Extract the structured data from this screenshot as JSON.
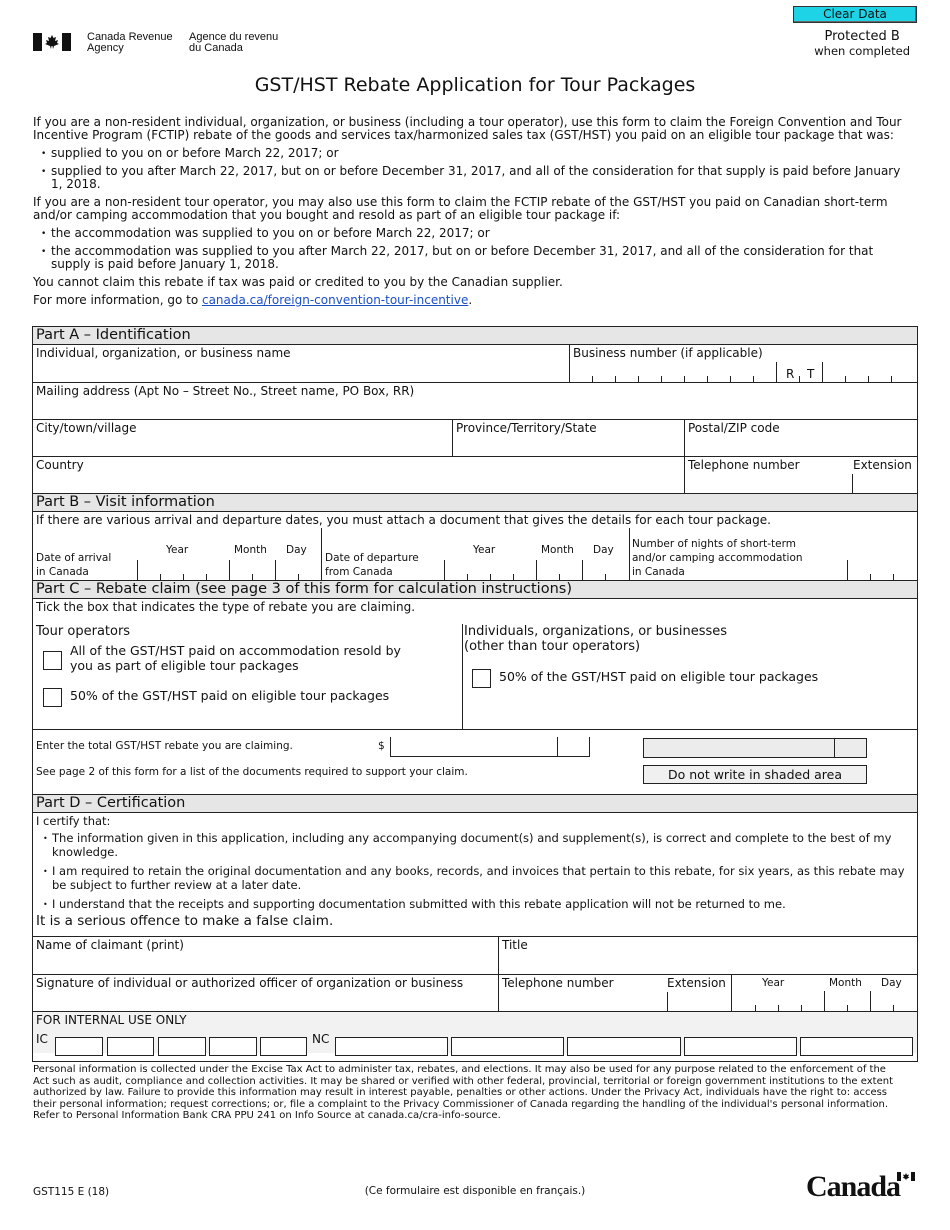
{
  "toolbar": {
    "clear_label": "Clear Data"
  },
  "header": {
    "agency_en_1": "Canada Revenue",
    "agency_en_2": "Agency",
    "agency_fr_1": "Agence du revenu",
    "agency_fr_2": "du Canada",
    "protected_1": "Protected B",
    "protected_2": "when completed",
    "title": "GST/HST Rebate Application for Tour Packages"
  },
  "intro": {
    "p1": "If you are a non-resident individual, organization, or business (including a tour operator), use this form to claim the Foreign Convention and Tour Incentive Program (FCTIP) rebate of the goods and services tax/harmonized sales tax (GST/HST) you paid on an eligible tour package that was:",
    "p1_bullets": [
      "supplied to you on or before March 22, 2017; or",
      "supplied to you after March 22, 2017, but on or before December 31, 2017, and all of the consideration for that supply is paid before January 1, 2018."
    ],
    "p2": "If you are a non-resident tour operator, you may also use this form to claim the FCTIP rebate of the GST/HST you paid on Canadian short-term and/or camping accommodation that you bought and resold as part of an eligible tour package if:",
    "p2_bullets": [
      "the accommodation was supplied to you on or before March 22, 2017; or",
      "the accommodation was supplied to you after March 22, 2017, but on or before December 31, 2017, and all of the consideration for that supply is paid before January 1, 2018."
    ],
    "p3": "You cannot claim this rebate if tax was paid or credited to you by the Canadian supplier.",
    "p4_prefix": "For more information, go to ",
    "p4_link": "canada.ca/foreign-convention-tour-incentive",
    "p4_suffix": "."
  },
  "part_a": {
    "header": "Part A – Identification",
    "name_label": "Individual, organization, or business name",
    "bn_label": "Business number (if applicable)",
    "bn_r": "R",
    "bn_t": "T",
    "address_label": "Mailing address (Apt No – Street No., Street name, PO Box, RR)",
    "city_label": "City/town/village",
    "province_label": "Province/Territory/State",
    "postal_label": "Postal/ZIP code",
    "country_label": "Country",
    "phone_label": "Telephone number",
    "extension_label": "Extension"
  },
  "part_b": {
    "header": "Part B – Visit information",
    "note": "If there are various arrival and departure dates, you must attach a document that gives the details for each tour package.",
    "arrival_label_1": "Date of arrival",
    "arrival_label_2": "in Canada",
    "departure_label_1": "Date of departure",
    "departure_label_2": "from Canada",
    "year": "Year",
    "month": "Month",
    "day": "Day",
    "nights_label_1": "Number of nights of short-term",
    "nights_label_2": "and/or camping accommodation",
    "nights_label_3": "in Canada"
  },
  "part_c": {
    "header": "Part C – Rebate claim (see page 3 of this form for calculation instructions)",
    "instruction": "Tick the box that indicates the type of rebate you are claiming.",
    "tour_ops_heading": "Tour operators",
    "tour_opt1_line1": "All of the GST/HST paid on accommodation resold by",
    "tour_opt1_line2": "you as part of eligible tour packages",
    "tour_opt2": "50% of the GST/HST paid on eligible tour packages",
    "others_heading_1": "Individuals, organizations, or businesses",
    "others_heading_2": "(other than tour operators)",
    "others_opt1": "50% of the GST/HST paid on eligible tour packages",
    "total_label": "Enter the total GST/HST rebate you are claiming.",
    "currency": "$",
    "see_page": "See page 2 of this form for a list of the documents required to support your claim.",
    "shaded_note": "Do not write in shaded area"
  },
  "part_d": {
    "header": "Part D – Certification",
    "certify": "I certify that:",
    "bullets": [
      "The information given in this application, including any accompanying document(s) and supplement(s), is correct and complete to the best of my knowledge.",
      "I am required to retain the original documentation and any books, records, and invoices that pertain to this rebate, for six years, as this rebate may be subject to further review at a later date.",
      "I understand that the receipts and supporting documentation submitted with this rebate application will not be returned to me."
    ],
    "warning": "It is a serious offence to make a false claim.",
    "claimant_label": "Name of claimant (print)",
    "title_label": "Title",
    "signature_label": "Signature of individual or authorized officer of organization or business",
    "phone_label": "Telephone number",
    "extension_label": "Extension",
    "year": "Year",
    "month": "Month",
    "day": "Day"
  },
  "internal": {
    "header": "FOR INTERNAL USE ONLY",
    "ic": "IC",
    "nc": "NC"
  },
  "privacy": "Personal information is collected under the Excise Tax Act to administer tax, rebates, and elections. It may also be used for any purpose related to the enforcement of the Act such as audit, compliance and collection activities. It may be shared or verified with other federal, provincial, territorial or foreign government institutions to the extent authorized by law. Failure to provide this information may result in interest payable, penalties or other actions. Under the Privacy Act, individuals have the right to: access their personal information; request corrections; or, file a complaint to the Privacy Commissioner of Canada regarding the handling of the individual's personal information. Refer to Personal Information Bank CRA PPU 241 on Info Source at canada.ca/cra-info-source.",
  "footer": {
    "form_id": "GST115 E (18)",
    "french": "(Ce formulaire est disponible en français.)",
    "wordmark": "Canada"
  }
}
